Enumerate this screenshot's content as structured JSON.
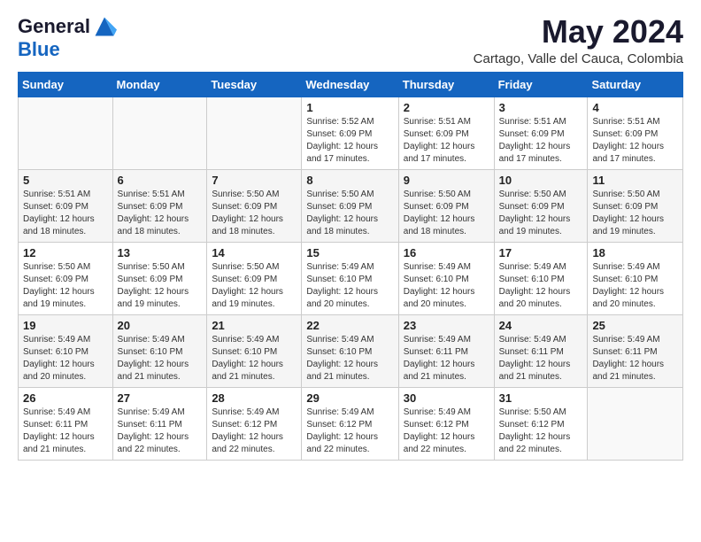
{
  "logo": {
    "general": "General",
    "blue": "Blue"
  },
  "title": "May 2024",
  "subtitle": "Cartago, Valle del Cauca, Colombia",
  "days_of_week": [
    "Sunday",
    "Monday",
    "Tuesday",
    "Wednesday",
    "Thursday",
    "Friday",
    "Saturday"
  ],
  "weeks": [
    [
      {
        "day": "",
        "info": ""
      },
      {
        "day": "",
        "info": ""
      },
      {
        "day": "",
        "info": ""
      },
      {
        "day": "1",
        "info": "Sunrise: 5:52 AM\nSunset: 6:09 PM\nDaylight: 12 hours and 17 minutes."
      },
      {
        "day": "2",
        "info": "Sunrise: 5:51 AM\nSunset: 6:09 PM\nDaylight: 12 hours and 17 minutes."
      },
      {
        "day": "3",
        "info": "Sunrise: 5:51 AM\nSunset: 6:09 PM\nDaylight: 12 hours and 17 minutes."
      },
      {
        "day": "4",
        "info": "Sunrise: 5:51 AM\nSunset: 6:09 PM\nDaylight: 12 hours and 17 minutes."
      }
    ],
    [
      {
        "day": "5",
        "info": "Sunrise: 5:51 AM\nSunset: 6:09 PM\nDaylight: 12 hours and 18 minutes."
      },
      {
        "day": "6",
        "info": "Sunrise: 5:51 AM\nSunset: 6:09 PM\nDaylight: 12 hours and 18 minutes."
      },
      {
        "day": "7",
        "info": "Sunrise: 5:50 AM\nSunset: 6:09 PM\nDaylight: 12 hours and 18 minutes."
      },
      {
        "day": "8",
        "info": "Sunrise: 5:50 AM\nSunset: 6:09 PM\nDaylight: 12 hours and 18 minutes."
      },
      {
        "day": "9",
        "info": "Sunrise: 5:50 AM\nSunset: 6:09 PM\nDaylight: 12 hours and 18 minutes."
      },
      {
        "day": "10",
        "info": "Sunrise: 5:50 AM\nSunset: 6:09 PM\nDaylight: 12 hours and 19 minutes."
      },
      {
        "day": "11",
        "info": "Sunrise: 5:50 AM\nSunset: 6:09 PM\nDaylight: 12 hours and 19 minutes."
      }
    ],
    [
      {
        "day": "12",
        "info": "Sunrise: 5:50 AM\nSunset: 6:09 PM\nDaylight: 12 hours and 19 minutes."
      },
      {
        "day": "13",
        "info": "Sunrise: 5:50 AM\nSunset: 6:09 PM\nDaylight: 12 hours and 19 minutes."
      },
      {
        "day": "14",
        "info": "Sunrise: 5:50 AM\nSunset: 6:09 PM\nDaylight: 12 hours and 19 minutes."
      },
      {
        "day": "15",
        "info": "Sunrise: 5:49 AM\nSunset: 6:10 PM\nDaylight: 12 hours and 20 minutes."
      },
      {
        "day": "16",
        "info": "Sunrise: 5:49 AM\nSunset: 6:10 PM\nDaylight: 12 hours and 20 minutes."
      },
      {
        "day": "17",
        "info": "Sunrise: 5:49 AM\nSunset: 6:10 PM\nDaylight: 12 hours and 20 minutes."
      },
      {
        "day": "18",
        "info": "Sunrise: 5:49 AM\nSunset: 6:10 PM\nDaylight: 12 hours and 20 minutes."
      }
    ],
    [
      {
        "day": "19",
        "info": "Sunrise: 5:49 AM\nSunset: 6:10 PM\nDaylight: 12 hours and 20 minutes."
      },
      {
        "day": "20",
        "info": "Sunrise: 5:49 AM\nSunset: 6:10 PM\nDaylight: 12 hours and 21 minutes."
      },
      {
        "day": "21",
        "info": "Sunrise: 5:49 AM\nSunset: 6:10 PM\nDaylight: 12 hours and 21 minutes."
      },
      {
        "day": "22",
        "info": "Sunrise: 5:49 AM\nSunset: 6:10 PM\nDaylight: 12 hours and 21 minutes."
      },
      {
        "day": "23",
        "info": "Sunrise: 5:49 AM\nSunset: 6:11 PM\nDaylight: 12 hours and 21 minutes."
      },
      {
        "day": "24",
        "info": "Sunrise: 5:49 AM\nSunset: 6:11 PM\nDaylight: 12 hours and 21 minutes."
      },
      {
        "day": "25",
        "info": "Sunrise: 5:49 AM\nSunset: 6:11 PM\nDaylight: 12 hours and 21 minutes."
      }
    ],
    [
      {
        "day": "26",
        "info": "Sunrise: 5:49 AM\nSunset: 6:11 PM\nDaylight: 12 hours and 21 minutes."
      },
      {
        "day": "27",
        "info": "Sunrise: 5:49 AM\nSunset: 6:11 PM\nDaylight: 12 hours and 22 minutes."
      },
      {
        "day": "28",
        "info": "Sunrise: 5:49 AM\nSunset: 6:12 PM\nDaylight: 12 hours and 22 minutes."
      },
      {
        "day": "29",
        "info": "Sunrise: 5:49 AM\nSunset: 6:12 PM\nDaylight: 12 hours and 22 minutes."
      },
      {
        "day": "30",
        "info": "Sunrise: 5:49 AM\nSunset: 6:12 PM\nDaylight: 12 hours and 22 minutes."
      },
      {
        "day": "31",
        "info": "Sunrise: 5:50 AM\nSunset: 6:12 PM\nDaylight: 12 hours and 22 minutes."
      },
      {
        "day": "",
        "info": ""
      }
    ]
  ]
}
